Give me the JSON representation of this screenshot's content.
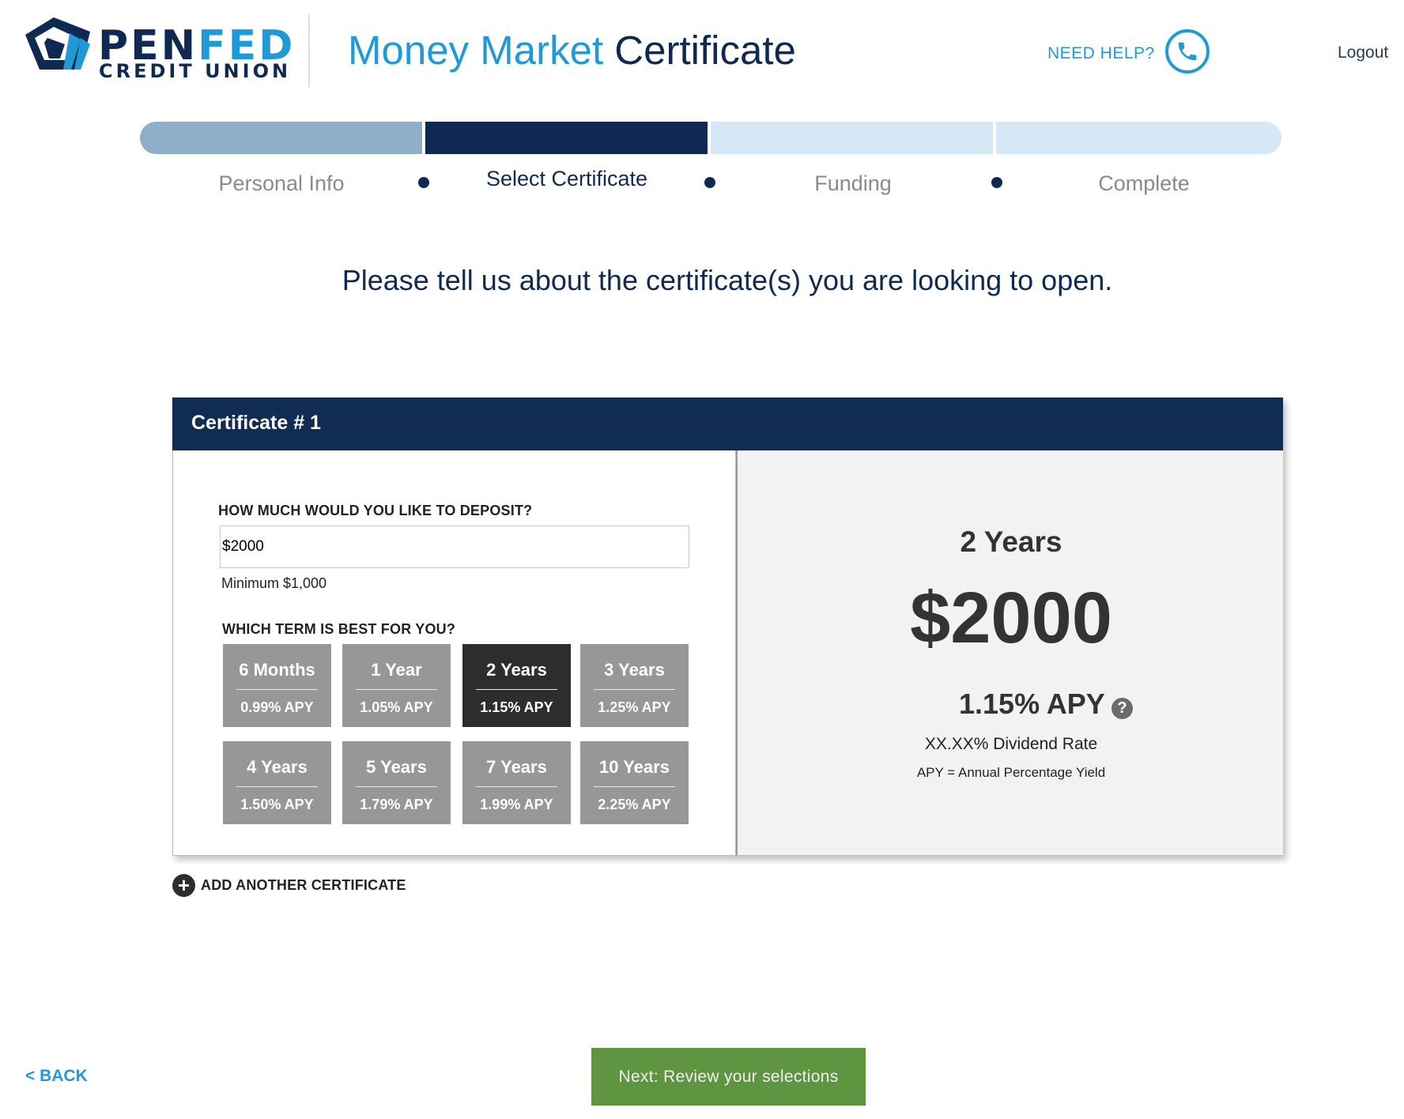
{
  "header": {
    "logo_primary_a": "PEN",
    "logo_primary_b": "FED",
    "logo_secondary": "CREDIT UNION",
    "title_accent": "Money Market",
    "title_rest": "Certificate",
    "need_help": "NEED HELP?",
    "logout": "Logout"
  },
  "progress": {
    "steps": [
      {
        "label": "Personal Info",
        "state": "done"
      },
      {
        "label": "Select Certificate",
        "state": "current"
      },
      {
        "label": "Funding",
        "state": "todo"
      },
      {
        "label": "Complete",
        "state": "todo"
      }
    ]
  },
  "intro": "Please tell us about the certificate(s) you are looking to open.",
  "certificate": {
    "title": "Certificate # 1",
    "deposit_label": "HOW MUCH WOULD YOU LIKE TO DEPOSIT?",
    "deposit_value": "$2000",
    "deposit_minimum": "Minimum $1,000",
    "term_label": "WHICH TERM IS BEST FOR YOU?",
    "terms": [
      {
        "name": "6 Months",
        "rate": "0.99% APY"
      },
      {
        "name": "1 Year",
        "rate": "1.05% APY"
      },
      {
        "name": "2 Years",
        "rate": "1.15% APY"
      },
      {
        "name": "3 Years",
        "rate": "1.25% APY"
      },
      {
        "name": "4 Years",
        "rate": "1.50% APY"
      },
      {
        "name": "5 Years",
        "rate": "1.79% APY"
      },
      {
        "name": "7 Years",
        "rate": "1.99% APY"
      },
      {
        "name": "10 Years",
        "rate": "2.25% APY"
      }
    ],
    "selected_term": "2 Years",
    "summary": {
      "term": "2 Years",
      "amount": "$2000",
      "apy": "1.15% APY",
      "help_glyph": "?",
      "dividend": "XX.XX% Dividend Rate",
      "apy_definition": "APY = Annual Percentage Yield"
    }
  },
  "add_another": {
    "icon_glyph": "+",
    "label": "ADD ANOTHER CERTIFICATE"
  },
  "footer": {
    "back": "< BACK",
    "next": "Next: Review your selections"
  },
  "colors": {
    "navy": "#0f2a52",
    "brand_blue": "#1f9ad6",
    "progress_done": "#8faec7",
    "progress_todo": "#d5e8f5",
    "term_default": "#979797",
    "term_selected": "#2d2d2d",
    "next_button": "#5f9540"
  }
}
